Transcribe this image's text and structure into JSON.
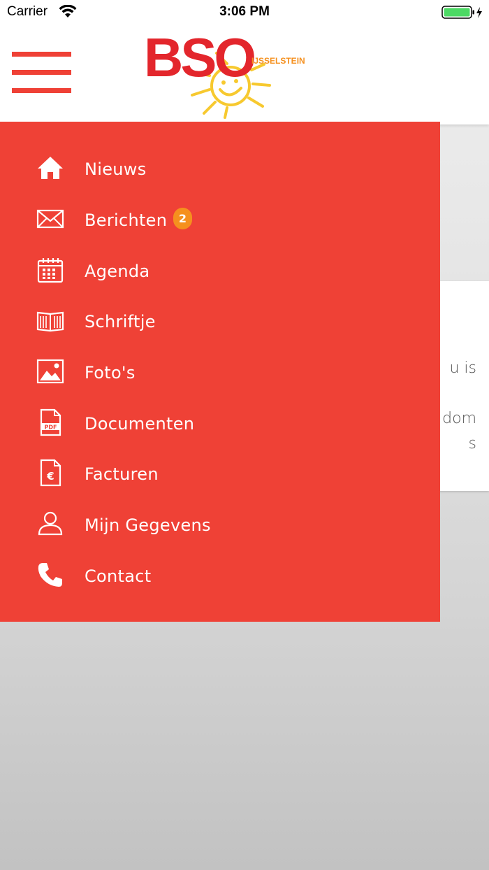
{
  "status_bar": {
    "carrier": "Carrier",
    "time": "3:06 PM"
  },
  "header": {
    "logo": {
      "text": "BSO",
      "subtext": "IJSSELSTEIN",
      "icon": "sun-logo-icon"
    },
    "menu_icon": "hamburger-icon"
  },
  "background_card": {
    "line1": "u is",
    "line2": "dom",
    "line3": "s"
  },
  "menu": {
    "items": [
      {
        "label": "Nieuws",
        "icon": "home-icon"
      },
      {
        "label": "Berichten",
        "icon": "envelope-icon",
        "badge": "2"
      },
      {
        "label": "Agenda",
        "icon": "calendar-icon"
      },
      {
        "label": "Schriftje",
        "icon": "book-icon"
      },
      {
        "label": "Foto's",
        "icon": "image-icon"
      },
      {
        "label": "Documenten",
        "icon": "pdf-icon"
      },
      {
        "label": "Facturen",
        "icon": "invoice-icon"
      },
      {
        "label": "Mijn Gegevens",
        "icon": "user-icon"
      },
      {
        "label": "Contact",
        "icon": "phone-icon"
      }
    ]
  },
  "colors": {
    "brand_red": "#ef4136",
    "badge_orange": "#f5901e",
    "logo_yellow": "#f7c92f"
  }
}
